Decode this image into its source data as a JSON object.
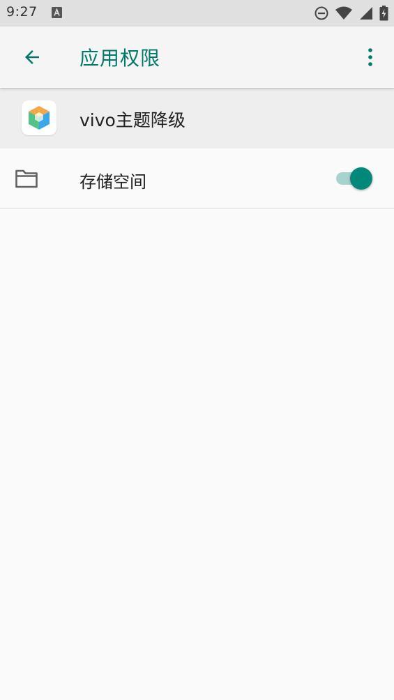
{
  "status_bar": {
    "time": "9:27",
    "icons": [
      "notification-a-icon",
      "do-not-disturb-icon",
      "wifi-icon",
      "signal-icon",
      "battery-charging-icon"
    ]
  },
  "app_bar": {
    "title": "应用权限",
    "back_icon": "arrow-back-icon",
    "more_icon": "more-vert-icon"
  },
  "app": {
    "name": "vivo主题降级",
    "icon": "cube-app-icon"
  },
  "permissions": [
    {
      "label": "存储空间",
      "icon": "folder-icon",
      "enabled": true
    }
  ],
  "colors": {
    "accent": "#00796b",
    "switch_thumb": "#00897b",
    "switch_track": "#a7d3cf"
  }
}
